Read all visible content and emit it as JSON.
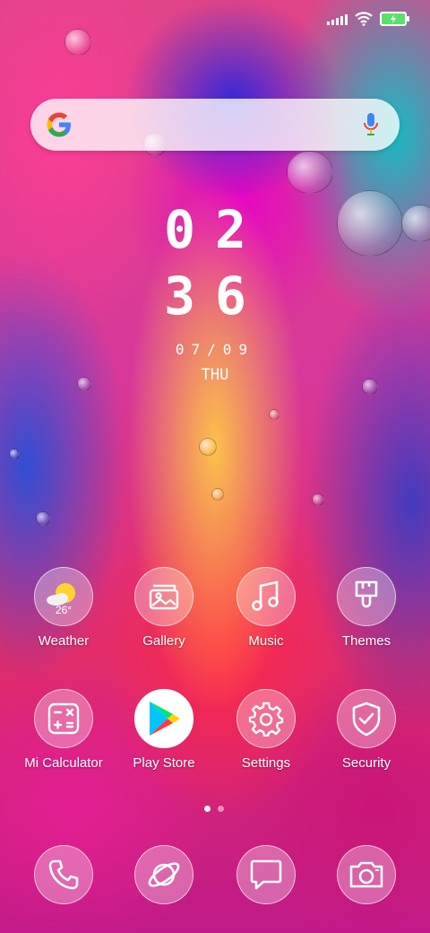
{
  "status": {
    "signal": "signal-icon",
    "wifi": "wifi-icon",
    "battery": "battery-charging-icon"
  },
  "search": {
    "logo": "google-logo",
    "mic": "microphone-icon"
  },
  "clock": {
    "hour": "02",
    "minute": "36",
    "date": "07/09",
    "day": "THU"
  },
  "apps_row1": [
    {
      "label": "Weather",
      "icon": "weather-icon",
      "temp": "26°"
    },
    {
      "label": "Gallery",
      "icon": "gallery-icon"
    },
    {
      "label": "Music",
      "icon": "music-icon"
    },
    {
      "label": "Themes",
      "icon": "themes-icon"
    }
  ],
  "apps_row2": [
    {
      "label": "Mi Calculator",
      "icon": "calculator-icon"
    },
    {
      "label": "Play Store",
      "icon": "play-store-icon"
    },
    {
      "label": "Settings",
      "icon": "settings-icon"
    },
    {
      "label": "Security",
      "icon": "security-icon"
    }
  ],
  "dock": [
    {
      "icon": "phone-icon"
    },
    {
      "icon": "browser-icon"
    },
    {
      "icon": "messages-icon"
    },
    {
      "icon": "camera-icon"
    }
  ],
  "page_indicator": {
    "count": 2,
    "active": 0
  }
}
